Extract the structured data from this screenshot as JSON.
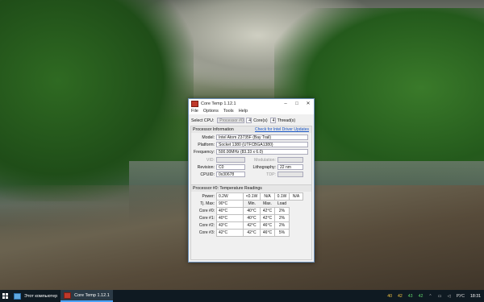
{
  "window": {
    "title": "Core Temp 1.12.1",
    "menu": [
      "File",
      "Options",
      "Tools",
      "Help"
    ],
    "select_cpu_label": "Select CPU:",
    "select_cpu_value": "Processor #0",
    "cores_count": "4",
    "cores_label": "Core(s)",
    "threads_count": "4",
    "threads_label": "Thread(s)",
    "processor_info_label": "Processor Information",
    "driver_link": "Check for Intel Driver Updates",
    "model_label": "Model:",
    "model_value": "Intel Atom  Z3735F (Bay Trail)",
    "platform_label": "Platform:",
    "platform_value": "Socket 1380 (UTFCBGA1380)",
    "frequency_label": "Frequency:",
    "frequency_value": "500.00MHz (83.33 x 6.0)",
    "vid_label": "VID:",
    "modulation_label": "Modulation:",
    "revision_label": "Revision:",
    "revision_value": "C0",
    "lithography_label": "Lithography:",
    "lithography_value": "22 nm",
    "cpuid_label": "CPUID:",
    "cpuid_value": "0x30678",
    "tdp_label": "TDP:",
    "readings_label": "Processor #0: Temperature Readings",
    "power_label": "Power:",
    "power_values": [
      "0.2W",
      "<0.1W",
      "N/A",
      "0.1W",
      "N/A"
    ],
    "tjmax_label": "Tj. Max:",
    "tjmax_value": "90°C",
    "col_min": "Min.",
    "col_max": "Max.",
    "col_load": "Load",
    "cores": [
      {
        "label": "Core #0:",
        "temp": "40°C",
        "min": "40°C",
        "max": "42°C",
        "load": "2%"
      },
      {
        "label": "Core #1:",
        "temp": "40°C",
        "min": "40°C",
        "max": "42°C",
        "load": "2%"
      },
      {
        "label": "Core #2:",
        "temp": "43°C",
        "min": "42°C",
        "max": "46°C",
        "load": "2%"
      },
      {
        "label": "Core #3:",
        "temp": "42°C",
        "min": "42°C",
        "max": "46°C",
        "load": "5%"
      }
    ]
  },
  "taskbar": {
    "items": [
      {
        "label": "Этот компьютер"
      },
      {
        "label": "Core Temp 1.12.1"
      }
    ],
    "tray_temps": [
      "40",
      "42",
      "43",
      "42"
    ],
    "language": "РУС",
    "time": "18:31"
  }
}
